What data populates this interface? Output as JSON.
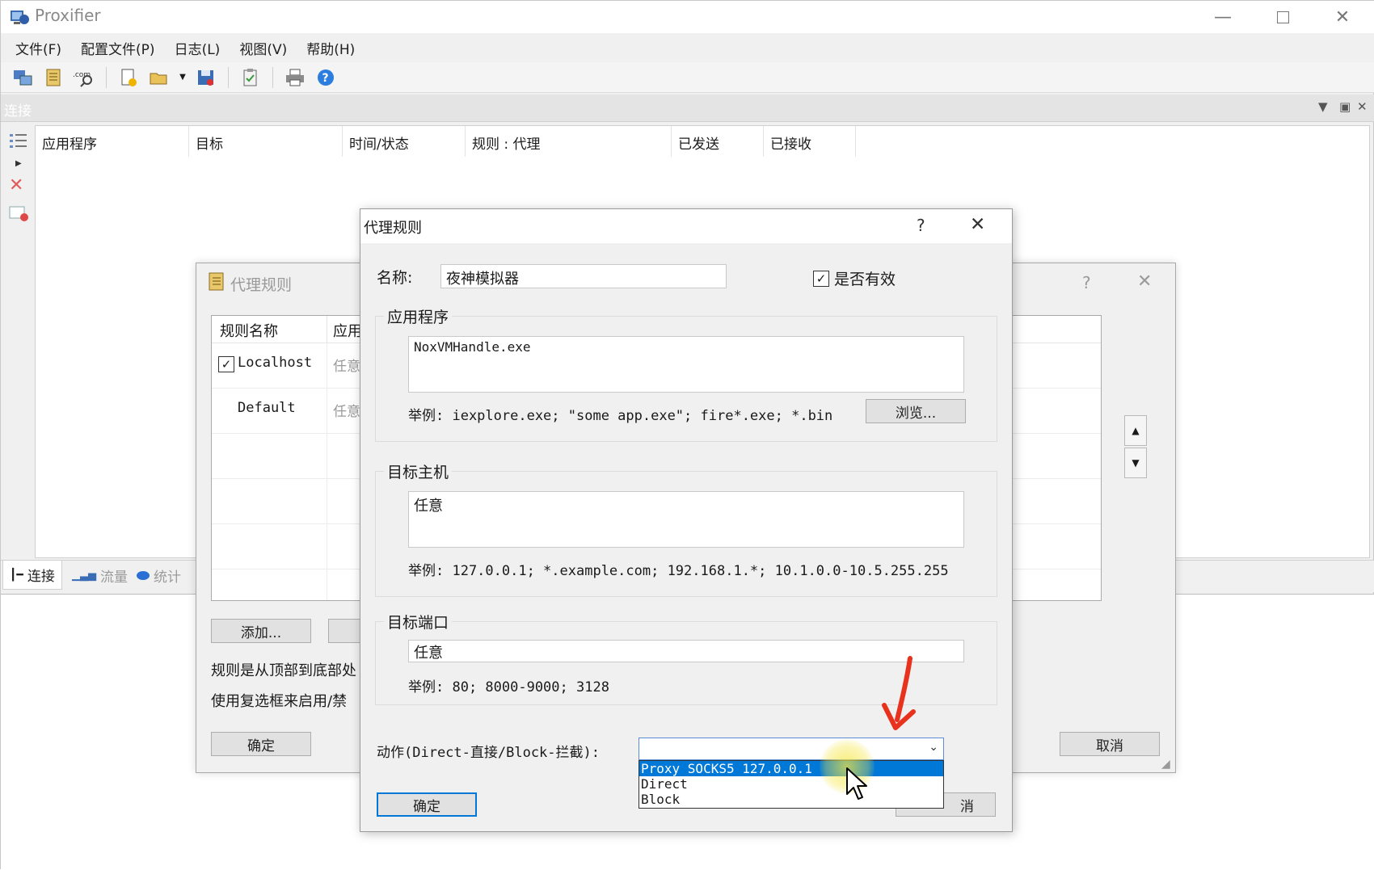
{
  "window": {
    "title": "Proxifier"
  },
  "menu": [
    "文件(F)",
    "配置文件(P)",
    "日志(L)",
    "视图(V)",
    "帮助(H)"
  ],
  "panel": {
    "title": "连接"
  },
  "connections": {
    "columns": [
      "应用程序",
      "目标",
      "时间/状态",
      "规则 : 代理",
      "已发送",
      "已接收"
    ]
  },
  "bottom_tabs": [
    "连接",
    "流量",
    "统计"
  ],
  "bg_dialog": {
    "title": "代理规则",
    "help": "?",
    "columns": [
      "规则名称",
      "应用"
    ],
    "rows": [
      {
        "name": "Localhost",
        "app": "任意",
        "checked": true
      },
      {
        "name": "Default",
        "app": "任意",
        "checked": false
      }
    ],
    "add_button": "添加...",
    "note1": "规则是从顶部到底部处",
    "note2": "使用复选框来启用/禁",
    "ok_button": "确定",
    "cancel_button": "取消"
  },
  "dialog": {
    "title": "代理规则",
    "help": "?",
    "name_label": "名称:",
    "name_value": "夜神模拟器",
    "enabled_label": "是否有效",
    "enabled": true,
    "apps_group": "应用程序",
    "apps_value": "NoxVMHandle.exe",
    "apps_example": "举例: iexplore.exe; \"some app.exe\"; fire*.exe; *.bin",
    "browse_button": "浏览...",
    "hosts_group": "目标主机",
    "hosts_value": "任意",
    "hosts_example": "举例: 127.0.0.1; *.example.com; 192.168.1.*; 10.1.0.0-10.5.255.255",
    "ports_group": "目标端口",
    "ports_value": "任意",
    "ports_example": "举例: 80; 8000-9000; 3128",
    "action_label": "动作(Direct-直接/Block-拦截):",
    "action_options": [
      "Proxy SOCKS5 127.0.0.1",
      "Direct",
      "Block"
    ],
    "ok_button": "确定",
    "cancel_button_partial": "消"
  },
  "colors": {
    "selection": "#0078d7",
    "annotation_arrow": "#e8321e",
    "cursor_highlight": "#f5e640"
  }
}
